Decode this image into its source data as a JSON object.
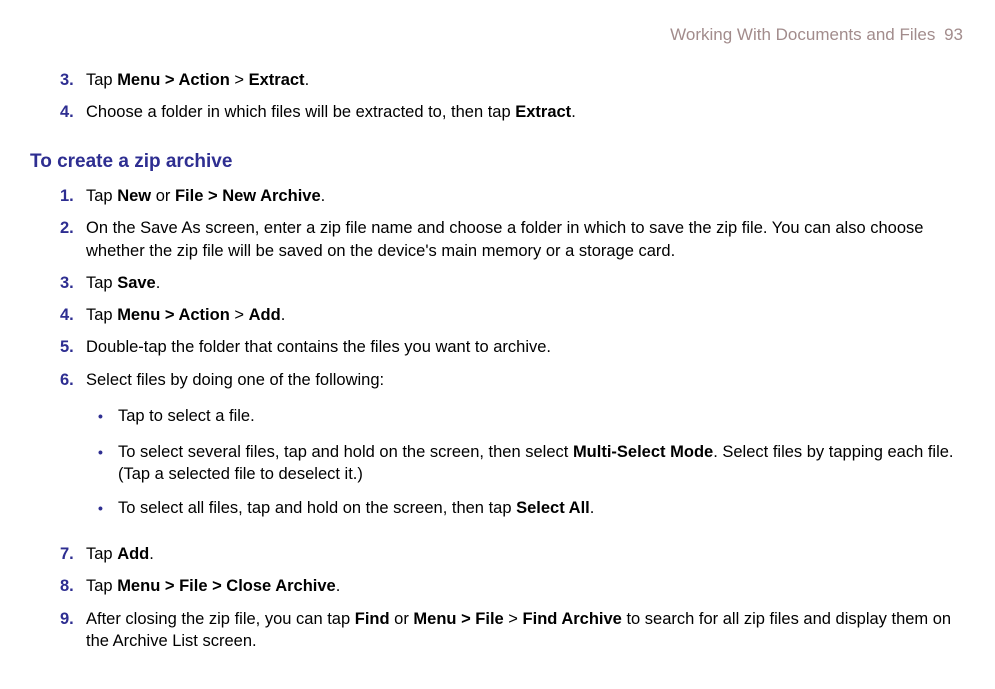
{
  "header": {
    "chapter": "Working With Documents and Files",
    "page": "93"
  },
  "intro_steps": [
    {
      "num": "3.",
      "parts": [
        {
          "t": "Tap ",
          "b": false
        },
        {
          "t": "Menu > Action",
          "b": true
        },
        {
          "t": " > ",
          "b": false
        },
        {
          "t": "Extract",
          "b": true
        },
        {
          "t": ".",
          "b": false
        }
      ]
    },
    {
      "num": "4.",
      "parts": [
        {
          "t": "Choose a folder in which files will be extracted to, then tap ",
          "b": false
        },
        {
          "t": "Extract",
          "b": true
        },
        {
          "t": ".",
          "b": false
        }
      ]
    }
  ],
  "section": {
    "heading": "To create a zip archive"
  },
  "main_steps": [
    {
      "num": "1.",
      "parts": [
        {
          "t": "Tap ",
          "b": false
        },
        {
          "t": "New",
          "b": true
        },
        {
          "t": " or ",
          "b": false
        },
        {
          "t": "File > New Archive",
          "b": true
        },
        {
          "t": ".",
          "b": false
        }
      ]
    },
    {
      "num": "2.",
      "parts": [
        {
          "t": "On the Save As screen, enter a zip file name and choose a folder in which to save the zip file. You can also choose whether the zip file will be saved on the device's main memory or a storage card.",
          "b": false
        }
      ]
    },
    {
      "num": "3.",
      "parts": [
        {
          "t": "Tap ",
          "b": false
        },
        {
          "t": "Save",
          "b": true
        },
        {
          "t": ".",
          "b": false
        }
      ]
    },
    {
      "num": "4.",
      "parts": [
        {
          "t": "Tap ",
          "b": false
        },
        {
          "t": "Menu > Action",
          "b": true
        },
        {
          "t": " > ",
          "b": false
        },
        {
          "t": "Add",
          "b": true
        },
        {
          "t": ".",
          "b": false
        }
      ]
    },
    {
      "num": "5.",
      "parts": [
        {
          "t": "Double-tap the folder that contains the files you want to archive.",
          "b": false
        }
      ]
    },
    {
      "num": "6.",
      "parts": [
        {
          "t": "Select files by doing one of the following:",
          "b": false
        }
      ],
      "subs": [
        {
          "parts": [
            {
              "t": "Tap to select a file.",
              "b": false
            }
          ]
        },
        {
          "parts": [
            {
              "t": "To select several files, tap and hold on the screen, then select ",
              "b": false
            },
            {
              "t": "Multi-Select Mode",
              "b": true
            },
            {
              "t": ". Select files by tapping each file. (Tap a selected file to deselect it.)",
              "b": false
            }
          ]
        },
        {
          "parts": [
            {
              "t": "To select all files, tap and hold on the screen, then tap ",
              "b": false
            },
            {
              "t": "Select All",
              "b": true
            },
            {
              "t": ".",
              "b": false
            }
          ]
        }
      ]
    },
    {
      "num": "7.",
      "parts": [
        {
          "t": "Tap ",
          "b": false
        },
        {
          "t": "Add",
          "b": true
        },
        {
          "t": ".",
          "b": false
        }
      ]
    },
    {
      "num": "8.",
      "parts": [
        {
          "t": "Tap ",
          "b": false
        },
        {
          "t": "Menu > File > Close Archive",
          "b": true
        },
        {
          "t": ".",
          "b": false
        }
      ]
    },
    {
      "num": "9.",
      "parts": [
        {
          "t": "After closing the zip file, you can tap ",
          "b": false
        },
        {
          "t": "Find",
          "b": true
        },
        {
          "t": " or ",
          "b": false
        },
        {
          "t": "Menu > File",
          "b": true
        },
        {
          "t": " > ",
          "b": false
        },
        {
          "t": "Find Archive",
          "b": true
        },
        {
          "t": " to search for all zip files and display them on the Archive List screen.",
          "b": false
        }
      ]
    }
  ]
}
